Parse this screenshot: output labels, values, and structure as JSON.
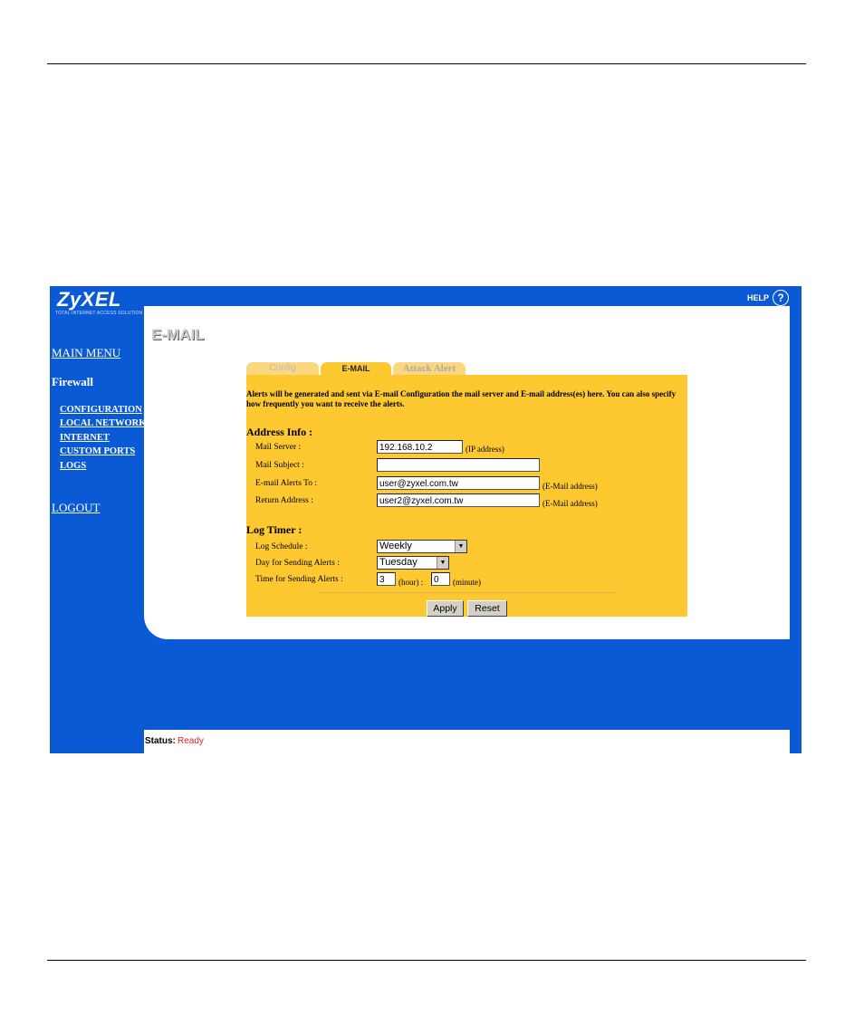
{
  "app": {
    "logo": "ZyXEL",
    "tagline": "TOTAL INTERNET ACCESS SOLUTION",
    "help_label": "HELP",
    "help_icon": "?"
  },
  "sidebar": {
    "main_menu": "MAIN MENU",
    "section_title": "Firewall",
    "items": [
      {
        "label": "CONFIGURATION"
      },
      {
        "label": "LOCAL NETWORK"
      },
      {
        "label": "INTERNET"
      },
      {
        "label": "CUSTOM PORTS"
      },
      {
        "label": "LOGS"
      }
    ],
    "logout": "LOGOUT"
  },
  "page": {
    "title": "E-MAIL",
    "tabs": [
      {
        "label": "Config"
      },
      {
        "label": "E-MAIL"
      },
      {
        "label": "Attack Alert"
      }
    ],
    "active_tab": "E-MAIL",
    "intro": "Alerts will be generated and sent via E-mail Configuration the mail server and E-mail address(es) here. You can also specify how frequently you want to receive the alerts."
  },
  "address_info": {
    "heading": "Address Info :",
    "mail_server": {
      "label": "Mail Server :",
      "value": "192.168.10.2",
      "note": "(IP address)"
    },
    "mail_subject": {
      "label": "Mail Subject :",
      "value": ""
    },
    "alerts_to": {
      "label": "E-mail Alerts To :",
      "value": "user@zyxel.com.tw",
      "note": "(E-Mail address)"
    },
    "return_address": {
      "label": "Return Address :",
      "value": "user2@zyxel.com.tw",
      "note": "(E-Mail address)"
    }
  },
  "log_timer": {
    "heading": "Log Timer :",
    "schedule": {
      "label": "Log Schedule :",
      "value": "Weekly"
    },
    "day": {
      "label": "Day for Sending Alerts :",
      "value": "Tuesday"
    },
    "time": {
      "label": "Time for Sending Alerts :",
      "hour": "3",
      "hour_unit": "(hour) :",
      "minute": "0",
      "minute_unit": "(minute)"
    }
  },
  "buttons": {
    "apply": "Apply",
    "reset": "Reset"
  },
  "status": {
    "label": "Status:",
    "value": "Ready",
    "value_color": "#e02020"
  },
  "colors": {
    "frame_blue": "#0a5ad6",
    "panel_yellow": "#fdc830",
    "tab_inactive": "#fbd780"
  }
}
